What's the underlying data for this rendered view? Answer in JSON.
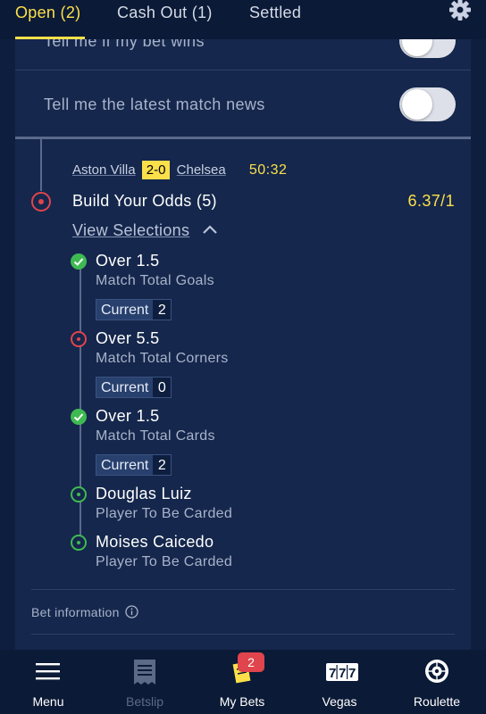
{
  "tabs": [
    {
      "label": "Open (2)"
    },
    {
      "label": "Cash Out (1)"
    },
    {
      "label": "Settled"
    }
  ],
  "preferences": [
    {
      "label": "Tell me if my bet wins",
      "enabled": false
    },
    {
      "label": "Tell me the latest match news",
      "enabled": false
    }
  ],
  "bet": {
    "home_team": "Aston Villa",
    "score": "2-0",
    "away_team": "Chelsea",
    "match_clock": "50:32",
    "title": "Build Your Odds (5)",
    "odds": "6.37/1",
    "view_selections_label": "View Selections",
    "current_label": "Current",
    "selections": [
      {
        "name": "Over 1.5",
        "market": "Match Total Goals",
        "current": "2",
        "status": "won"
      },
      {
        "name": "Over 5.5",
        "market": "Match Total Corners",
        "current": "0",
        "status": "losing"
      },
      {
        "name": "Over 1.5",
        "market": "Match Total Cards",
        "current": "2",
        "status": "won"
      },
      {
        "name": "Douglas Luiz",
        "market": "Player To Be Carded",
        "status": "open"
      },
      {
        "name": "Moises Caicedo",
        "market": "Player To Be Carded",
        "status": "open"
      }
    ],
    "info_label": "Bet information"
  },
  "nav": {
    "items": [
      {
        "label": "Menu",
        "icon": "hamburger-icon"
      },
      {
        "label": "Betslip",
        "icon": "receipt-icon",
        "disabled": true
      },
      {
        "label": "My Bets",
        "icon": "ticket-icon",
        "badge": "2"
      },
      {
        "label": "Vegas",
        "icon": "slot-777-icon"
      },
      {
        "label": "Roulette",
        "icon": "roulette-wheel-icon"
      }
    ]
  },
  "colors": {
    "accent": "#fce04a",
    "background": "#0d1e3f",
    "card": "#15274c",
    "win": "#3fba52",
    "lose": "#e0444c"
  }
}
